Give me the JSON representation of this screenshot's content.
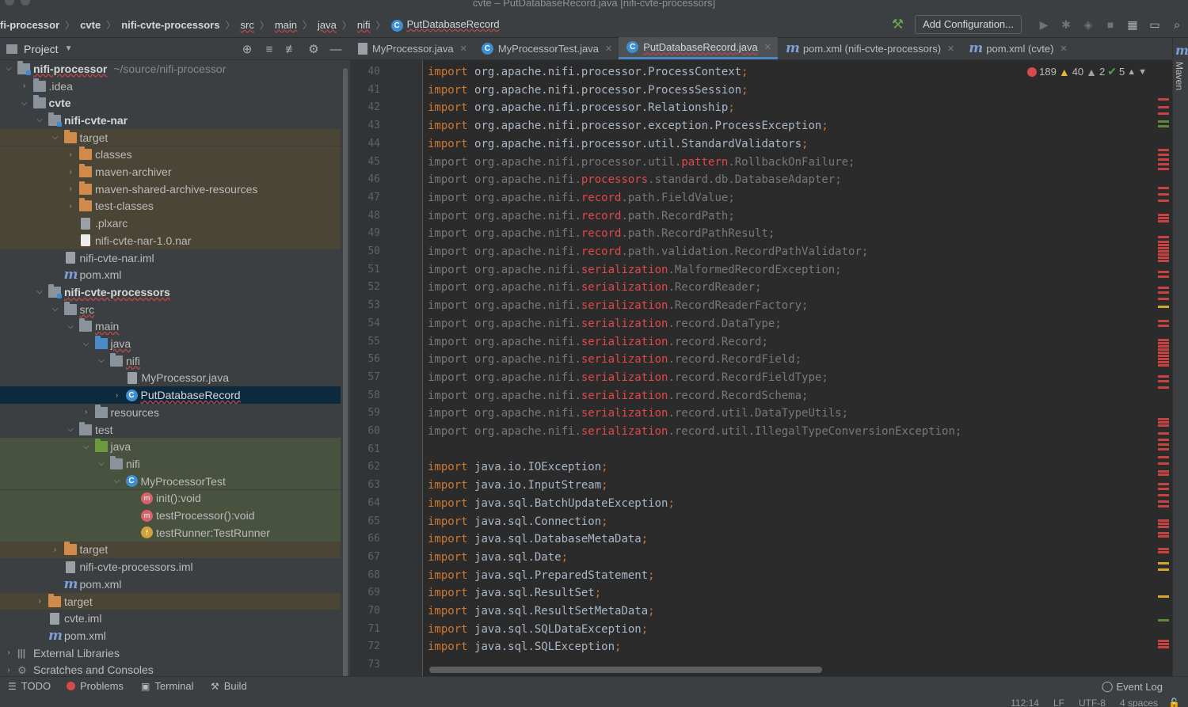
{
  "window": {
    "title": "cvte – PutDatabaseRecord.java [nifi-cvte-processors]"
  },
  "breadcrumbs": [
    {
      "label": "fi-processor",
      "style": "plain"
    },
    {
      "label": "cvte",
      "style": "plain"
    },
    {
      "label": "nifi-cvte-processors",
      "style": "plain"
    },
    {
      "label": "src",
      "style": "err"
    },
    {
      "label": "main",
      "style": "err"
    },
    {
      "label": "java",
      "style": "err"
    },
    {
      "label": "nifi",
      "style": "err"
    },
    {
      "label": "PutDatabaseRecord",
      "style": "err",
      "icon": "class-icon"
    }
  ],
  "toolbar": {
    "add_configuration": "Add Configuration..."
  },
  "project": {
    "title": "Project"
  },
  "tree": [
    {
      "depth": 0,
      "arrow": "down",
      "icon": "folder-mod",
      "label": "nifi-processor",
      "hint": "~/source/nifi-processor",
      "style": "bold ul",
      "bg": ""
    },
    {
      "depth": 1,
      "arrow": "right",
      "icon": "folder",
      "label": ".idea",
      "bg": ""
    },
    {
      "depth": 1,
      "arrow": "down",
      "icon": "folder",
      "label": "cvte",
      "style": "bold",
      "bg": ""
    },
    {
      "depth": 2,
      "arrow": "down",
      "icon": "folder-mod",
      "label": "nifi-cvte-nar",
      "style": "bold",
      "bg": ""
    },
    {
      "depth": 3,
      "arrow": "down",
      "icon": "folder-orange",
      "label": "target",
      "bg": "brown"
    },
    {
      "depth": 4,
      "arrow": "right",
      "icon": "folder-orange",
      "label": "classes",
      "bg": "brown"
    },
    {
      "depth": 4,
      "arrow": "right",
      "icon": "folder-orange",
      "label": "maven-archiver",
      "bg": "brown"
    },
    {
      "depth": 4,
      "arrow": "right",
      "icon": "folder-orange",
      "label": "maven-shared-archive-resources",
      "bg": "brown"
    },
    {
      "depth": 4,
      "arrow": "right",
      "icon": "folder-orange",
      "label": "test-classes",
      "bg": "brown"
    },
    {
      "depth": 4,
      "arrow": "",
      "icon": "file-gray",
      "label": ".plxarc",
      "bg": "brown"
    },
    {
      "depth": 4,
      "arrow": "",
      "icon": "file",
      "label": "nifi-cvte-nar-1.0.nar",
      "bg": "brown"
    },
    {
      "depth": 3,
      "arrow": "",
      "icon": "file-gray",
      "label": "nifi-cvte-nar.iml",
      "bg": ""
    },
    {
      "depth": 3,
      "arrow": "",
      "icon": "maven",
      "label": "pom.xml",
      "bg": ""
    },
    {
      "depth": 2,
      "arrow": "down",
      "icon": "folder-mod",
      "label": "nifi-cvte-processors",
      "style": "bold ul",
      "bg": ""
    },
    {
      "depth": 3,
      "arrow": "down",
      "icon": "folder",
      "label": "src",
      "style": "ul",
      "bg": ""
    },
    {
      "depth": 4,
      "arrow": "down",
      "icon": "folder",
      "label": "main",
      "style": "ul",
      "bg": ""
    },
    {
      "depth": 5,
      "arrow": "down",
      "icon": "folder-blue",
      "label": "java",
      "style": "ul",
      "bg": ""
    },
    {
      "depth": 6,
      "arrow": "down",
      "icon": "folder",
      "label": "nifi",
      "style": "ul",
      "bg": ""
    },
    {
      "depth": 7,
      "arrow": "",
      "icon": "java-file",
      "label": "MyProcessor.java",
      "bg": ""
    },
    {
      "depth": 7,
      "arrow": "right",
      "icon": "class",
      "label": "PutDatabaseRecord",
      "style": "ul link",
      "bg": "selected"
    },
    {
      "depth": 5,
      "arrow": "right",
      "icon": "folder",
      "label": "resources",
      "bg": ""
    },
    {
      "depth": 4,
      "arrow": "down",
      "icon": "folder",
      "label": "test",
      "bg": ""
    },
    {
      "depth": 5,
      "arrow": "down",
      "icon": "folder-green",
      "label": "java",
      "bg": "green"
    },
    {
      "depth": 6,
      "arrow": "down",
      "icon": "folder",
      "label": "nifi",
      "bg": "green"
    },
    {
      "depth": 7,
      "arrow": "down",
      "icon": "class",
      "label": "MyProcessorTest",
      "bg": "green"
    },
    {
      "depth": 8,
      "arrow": "",
      "icon": "method",
      "label": "init():void",
      "bg": "green"
    },
    {
      "depth": 8,
      "arrow": "",
      "icon": "method2",
      "label": "testProcessor():void",
      "bg": "green"
    },
    {
      "depth": 8,
      "arrow": "",
      "icon": "field",
      "label": "testRunner:TestRunner",
      "bg": "green"
    },
    {
      "depth": 3,
      "arrow": "right",
      "icon": "folder-orange",
      "label": "target",
      "bg": "brown"
    },
    {
      "depth": 3,
      "arrow": "",
      "icon": "file-gray",
      "label": "nifi-cvte-processors.iml",
      "bg": ""
    },
    {
      "depth": 3,
      "arrow": "",
      "icon": "maven",
      "label": "pom.xml",
      "bg": ""
    },
    {
      "depth": 2,
      "arrow": "right",
      "icon": "folder-orange",
      "label": "target",
      "bg": "brown"
    },
    {
      "depth": 2,
      "arrow": "",
      "icon": "file-gray",
      "label": "cvte.iml",
      "bg": ""
    },
    {
      "depth": 2,
      "arrow": "",
      "icon": "maven",
      "label": "pom.xml",
      "bg": ""
    },
    {
      "depth": 0,
      "arrow": "right",
      "icon": "libs",
      "label": "External Libraries",
      "bg": ""
    },
    {
      "depth": 0,
      "arrow": "right",
      "icon": "scratch",
      "label": "Scratches and Consoles",
      "bg": ""
    }
  ],
  "tabs": [
    {
      "label": "MyProcessor.java",
      "icon": "java",
      "active": false
    },
    {
      "label": "MyProcessorTest.java",
      "icon": "class",
      "active": false
    },
    {
      "label": "PutDatabaseRecord.java",
      "icon": "class",
      "active": true
    },
    {
      "label": "pom.xml (nifi-cvte-processors)",
      "icon": "maven",
      "active": false
    },
    {
      "label": "pom.xml (cvte)",
      "icon": "maven",
      "active": false
    }
  ],
  "inspections": {
    "errors": "189",
    "warnings": "40",
    "weak_warnings": "2",
    "typos": "5"
  },
  "code": [
    {
      "n": "40",
      "t": "a",
      "c": "org.apache.nifi.processor.ProcessContext"
    },
    {
      "n": "41",
      "t": "a",
      "c": "org.apache.nifi.processor.ProcessSession"
    },
    {
      "n": "42",
      "t": "a",
      "c": "org.apache.nifi.processor.Relationship"
    },
    {
      "n": "43",
      "t": "a",
      "c": "org.apache.nifi.processor.exception.ProcessException"
    },
    {
      "n": "44",
      "t": "a",
      "c": "org.apache.nifi.processor.util.StandardValidators"
    },
    {
      "n": "45",
      "t": "d",
      "p": "org.apache.nifi.processor.util.",
      "e": "pattern",
      "s": ".RollbackOnFailure"
    },
    {
      "n": "46",
      "t": "d",
      "p": "org.apache.nifi.",
      "e": "processors",
      "s": ".standard.db.DatabaseAdapter"
    },
    {
      "n": "47",
      "t": "d",
      "p": "org.apache.nifi.",
      "e": "record",
      "s": ".path.FieldValue"
    },
    {
      "n": "48",
      "t": "d",
      "p": "org.apache.nifi.",
      "e": "record",
      "s": ".path.RecordPath"
    },
    {
      "n": "49",
      "t": "d",
      "p": "org.apache.nifi.",
      "e": "record",
      "s": ".path.RecordPathResult"
    },
    {
      "n": "50",
      "t": "d",
      "p": "org.apache.nifi.",
      "e": "record",
      "s": ".path.validation.RecordPathValidator"
    },
    {
      "n": "51",
      "t": "d",
      "p": "org.apache.nifi.",
      "e": "serialization",
      "s": ".MalformedRecordException"
    },
    {
      "n": "52",
      "t": "d",
      "p": "org.apache.nifi.",
      "e": "serialization",
      "s": ".RecordReader"
    },
    {
      "n": "53",
      "t": "d",
      "p": "org.apache.nifi.",
      "e": "serialization",
      "s": ".RecordReaderFactory"
    },
    {
      "n": "54",
      "t": "d",
      "p": "org.apache.nifi.",
      "e": "serialization",
      "s": ".record.DataType"
    },
    {
      "n": "55",
      "t": "d",
      "p": "org.apache.nifi.",
      "e": "serialization",
      "s": ".record.Record"
    },
    {
      "n": "56",
      "t": "d",
      "p": "org.apache.nifi.",
      "e": "serialization",
      "s": ".record.RecordField"
    },
    {
      "n": "57",
      "t": "d",
      "p": "org.apache.nifi.",
      "e": "serialization",
      "s": ".record.RecordFieldType"
    },
    {
      "n": "58",
      "t": "d",
      "p": "org.apache.nifi.",
      "e": "serialization",
      "s": ".record.RecordSchema"
    },
    {
      "n": "59",
      "t": "d",
      "p": "org.apache.nifi.",
      "e": "serialization",
      "s": ".record.util.DataTypeUtils"
    },
    {
      "n": "60",
      "t": "d",
      "p": "org.apache.nifi.",
      "e": "serialization",
      "s": ".record.util.IllegalTypeConversionException"
    },
    {
      "n": "61",
      "t": "blank"
    },
    {
      "n": "62",
      "t": "a",
      "c": "java.io.IOException"
    },
    {
      "n": "63",
      "t": "a",
      "c": "java.io.InputStream"
    },
    {
      "n": "64",
      "t": "a",
      "c": "java.sql.BatchUpdateException"
    },
    {
      "n": "65",
      "t": "a",
      "c": "java.sql.Connection"
    },
    {
      "n": "66",
      "t": "a",
      "c": "java.sql.DatabaseMetaData"
    },
    {
      "n": "67",
      "t": "a",
      "c": "java.sql.Date"
    },
    {
      "n": "68",
      "t": "a",
      "c": "java.sql.PreparedStatement"
    },
    {
      "n": "69",
      "t": "a",
      "c": "java.sql.ResultSet"
    },
    {
      "n": "70",
      "t": "a",
      "c": "java.sql.ResultSetMetaData"
    },
    {
      "n": "71",
      "t": "a",
      "c": "java.sql.SQLDataException"
    },
    {
      "n": "72",
      "t": "a",
      "c": "java.sql.SQLException"
    },
    {
      "n": "73",
      "t": "blank"
    }
  ],
  "rightbar": {
    "maven": "Maven"
  },
  "statusbar": {
    "tools": [
      {
        "label": "TODO",
        "icon": "list-icon"
      },
      {
        "label": "Problems",
        "icon": "problems-icon"
      },
      {
        "label": "Terminal",
        "icon": "terminal-icon"
      },
      {
        "label": "Build",
        "icon": "build-icon"
      }
    ],
    "event_log": "Event Log",
    "position": "112:14",
    "line_sep": "LF",
    "encoding": "UTF-8",
    "indent": "4 spaces"
  },
  "colors": {
    "error": "#e0484a",
    "keyword": "#cc7832",
    "text": "#a9b7c6",
    "selection": "#0d293e",
    "accent": "#4a88c7"
  }
}
